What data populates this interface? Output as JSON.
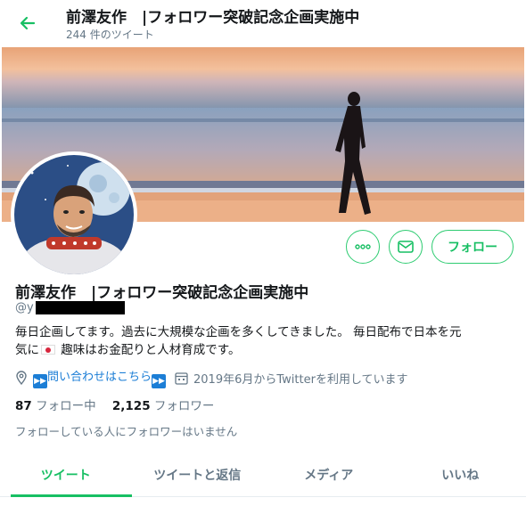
{
  "header": {
    "title": "前澤友作　|フォロワー突破記念企画実施中",
    "tweet_count": "244 件のツイート"
  },
  "profile": {
    "name": "前澤友作　|フォロワー突破記念企画実施中",
    "handle_prefix": "@y",
    "bio_line1": "毎日企画してます。過去に大規模な企画を多くしてきました。 毎日配布で日本を元",
    "bio_pre_flag": "気に",
    "bio_post_flag": " 趣味はお金配りと人材育成です。",
    "link_prefix_icon": "▶▶",
    "link_text": "問い合わせはこちら",
    "link_suffix_icon": "▶▶",
    "joined": "2019年6月からTwitterを利用しています",
    "following_count": "87",
    "following_label": "フォロー中",
    "followers_count": "2,125",
    "followers_label": "フォロワー",
    "notice": "フォローしている人にフォロワーはいません"
  },
  "actions": {
    "follow_label": "フォロー"
  },
  "tabs": [
    {
      "label": "ツイート",
      "active": true
    },
    {
      "label": "ツイートと返信",
      "active": false
    },
    {
      "label": "メディア",
      "active": false
    },
    {
      "label": "いいね",
      "active": false
    }
  ],
  "colors": {
    "accent": "#17bf63",
    "link": "#1c7ed6",
    "muted": "#657786"
  }
}
